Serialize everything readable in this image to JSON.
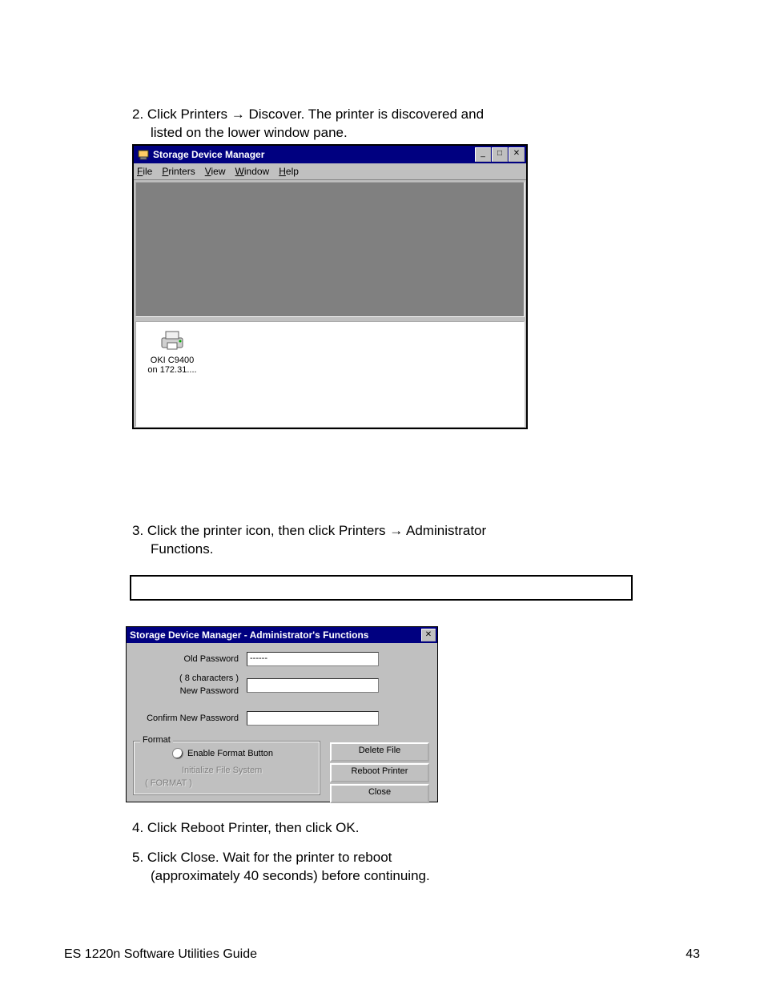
{
  "doc": {
    "step2_line1": "2. Click Printers → Discover. The printer is discovered and",
    "step2_line2": "listed on the lower window pane.",
    "step3_line1": "3. Click the printer icon, then click Printers → Administrator",
    "step3_line2": "Functions.",
    "step4_line1": "4. Click Reboot Printer, then click OK.",
    "step5_line1": "5. Click Close. Wait for the printer to reboot",
    "step5_line2": "(approximately 40 seconds) before continuing.",
    "footer_left": "ES 1220n Software Utilities Guide",
    "footer_right": "43"
  },
  "win1": {
    "title": "Storage Device Manager",
    "menus": {
      "file": "File",
      "printers": "Printers",
      "view": "View",
      "window": "Window",
      "help": "Help"
    },
    "wincontrols": {
      "min": "_",
      "max": "□",
      "close": "✕"
    },
    "printer": {
      "line1": "OKI C9400",
      "line2": "on 172.31...."
    }
  },
  "instruction": "",
  "win2": {
    "title": "Storage Device Manager - Administrator's Functions",
    "close_glyph": "✕",
    "labels": {
      "old_password": "Old Password",
      "chars": "( 8 characters )",
      "new_password": "New Password",
      "confirm": "Confirm New Password"
    },
    "fields": {
      "old_password_value": "------"
    },
    "group": {
      "legend": "Format",
      "radio_label": "Enable Format Button",
      "disabled_button": "Initialize File System",
      "disabled_hint": "( FORMAT )"
    },
    "buttons": {
      "delete": "Delete File",
      "reboot": "Reboot Printer",
      "close": "Close"
    }
  }
}
